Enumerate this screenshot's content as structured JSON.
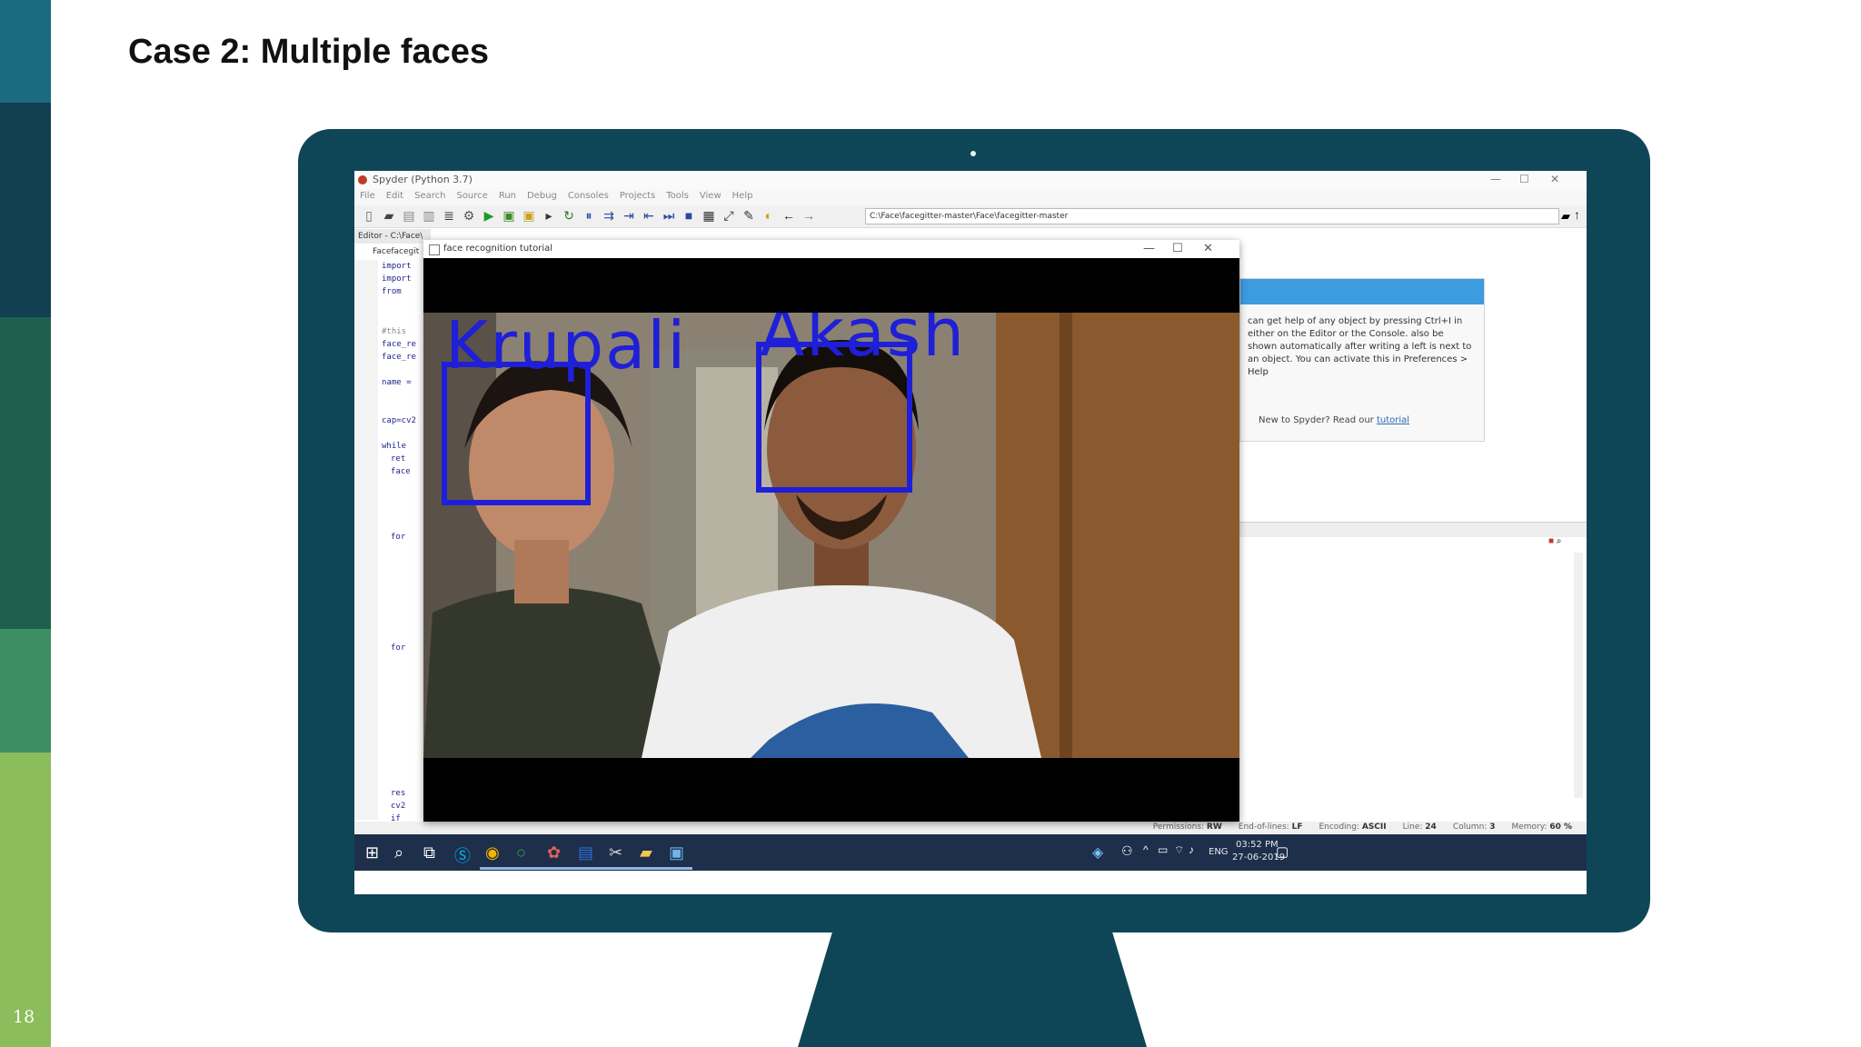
{
  "slide": {
    "title": "Case 2: Multiple faces",
    "number": "18",
    "colors": {
      "monitor": "#0f4657",
      "stripe": [
        "#1b6b80",
        "#123f52",
        "#1f5f4e",
        "#3b8f63",
        "#8cbd5c"
      ]
    }
  },
  "ide": {
    "title": "Spyder (Python 3.7)",
    "menu": [
      "File",
      "Edit",
      "Search",
      "Source",
      "Run",
      "Debug",
      "Consoles",
      "Projects",
      "Tools",
      "View",
      "Help"
    ],
    "path": "C:\\Face\\facegitter-master\\Face\\facegitter-master",
    "editor_tab": "Editor - C:\\Face\\",
    "file_tab": "Facefacegit",
    "code_lines": [
      "import",
      "import",
      "from",
      "#this",
      "face_re",
      "face_re",
      "name =",
      "cap=cv2",
      "while",
      "ret",
      "face",
      "for",
      "for",
      "res",
      "cv2",
      "if"
    ],
    "help": {
      "text": "can get help of any object by pressing Ctrl+I in either on the Editor or the Console. also be shown automatically after writing a left is next to an object. You can activate this in Preferences > Help",
      "new_prefix": "New to Spyder? Read our",
      "link": "tutorial"
    },
    "status": {
      "permissions_label": "Permissions:",
      "permissions": "RW",
      "eol_label": "End-of-lines:",
      "eol": "LF",
      "encoding_label": "Encoding:",
      "encoding": "ASCII",
      "line_label": "Line:",
      "line": "24",
      "column_label": "Column:",
      "column": "3",
      "memory_label": "Memory:",
      "memory": "60 %"
    }
  },
  "face_window": {
    "title": "face recognition tutorial",
    "faces": [
      {
        "name": "Krupali"
      },
      {
        "name": "Akash"
      }
    ]
  },
  "taskbar": {
    "language": "ENG",
    "time": "03:52 PM",
    "date": "27-06-2019"
  }
}
